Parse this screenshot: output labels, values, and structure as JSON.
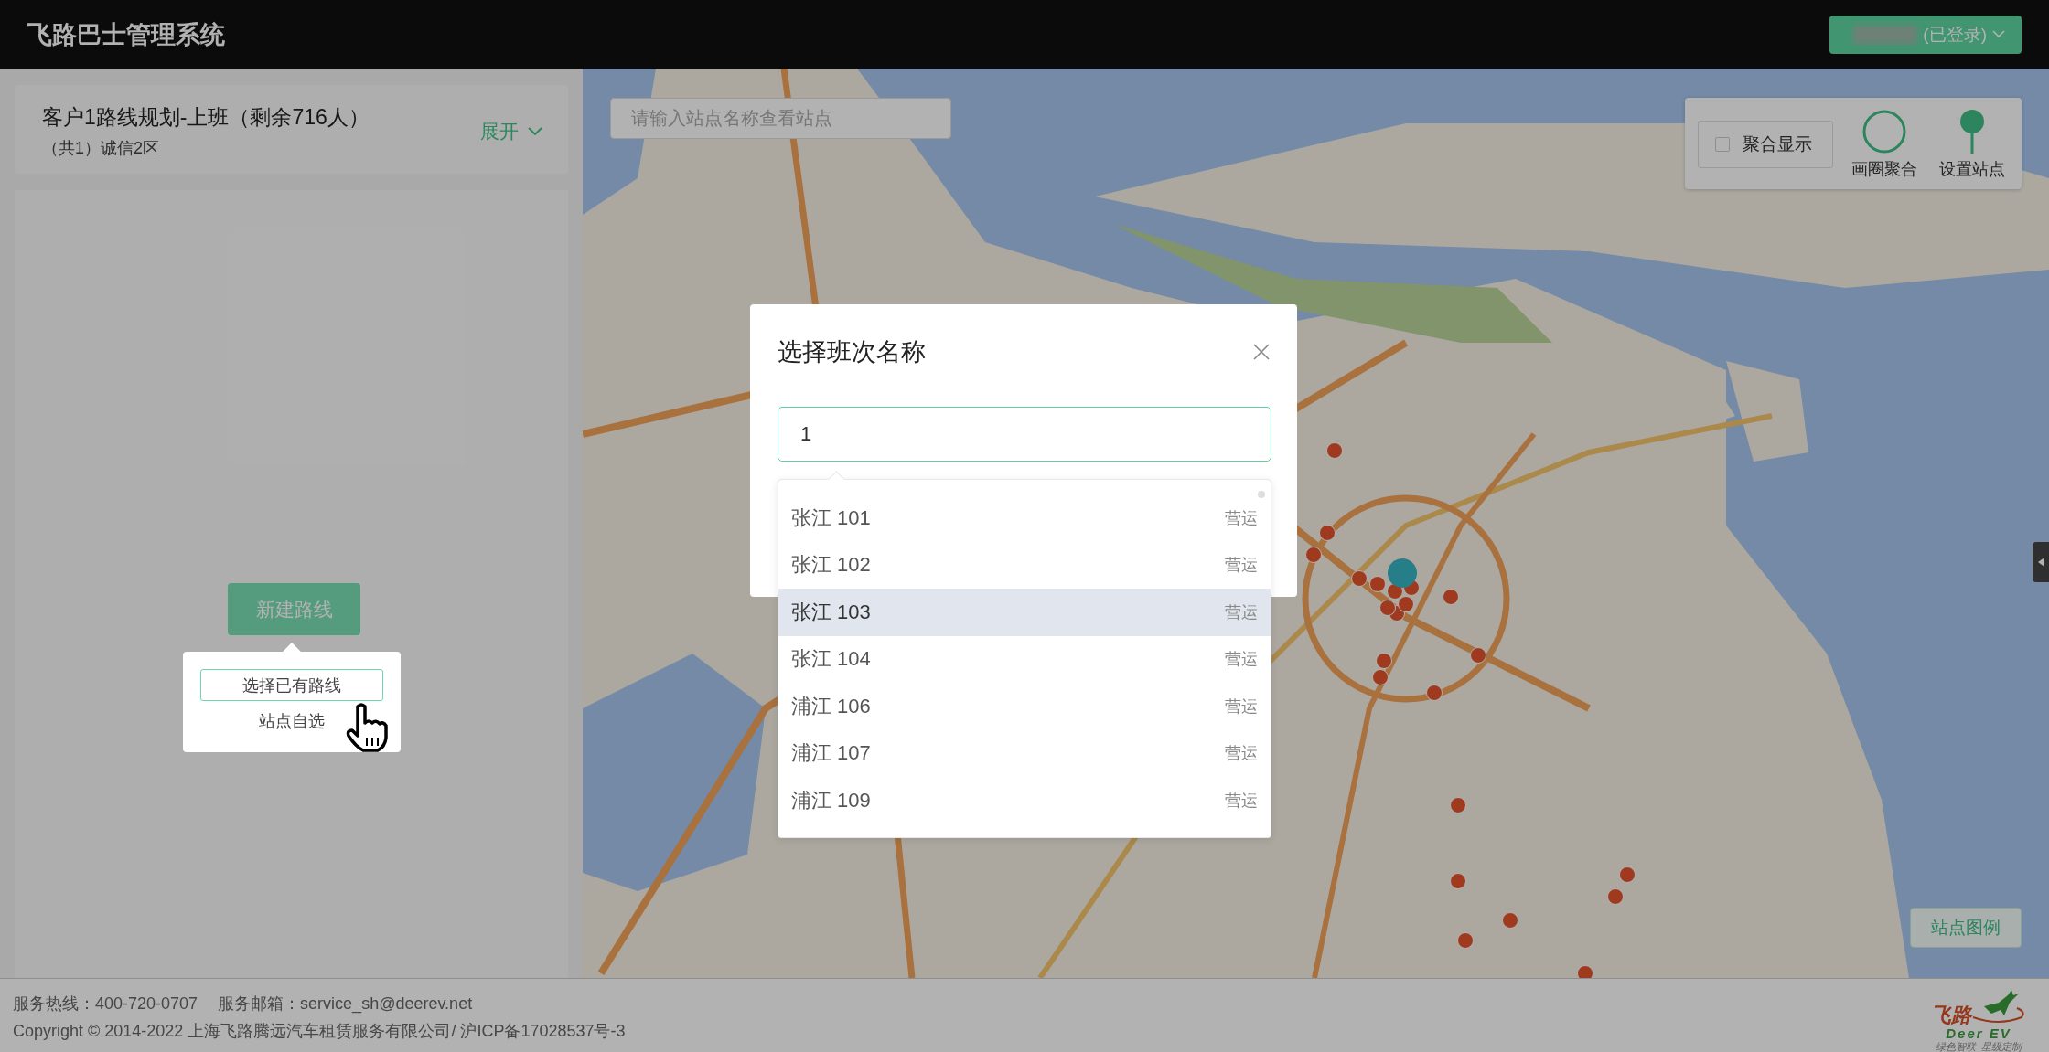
{
  "header": {
    "title": "飞路巴士管理系统",
    "user_button": {
      "label": "(已登录)"
    }
  },
  "route_card": {
    "title": "客户1路线规划-上班（剩余716人）",
    "subtitle": "（共1）诚信2区",
    "expand_label": "展开"
  },
  "new_route_button": {
    "label": "新建路线"
  },
  "new_route_menu": [
    {
      "label": "选择已有路线",
      "highlighted": true
    },
    {
      "label": "站点自选",
      "highlighted": false
    }
  ],
  "map": {
    "search": {
      "placeholder": "请输入站点名称查看站点"
    },
    "cluster_toggle": {
      "label": "聚合显示",
      "checked": false
    },
    "tools": [
      {
        "kind": "circle",
        "label": "画圈聚合"
      },
      {
        "kind": "pin",
        "label": "设置站点"
      }
    ],
    "legend_button": {
      "label": "站点图例"
    }
  },
  "dialog": {
    "title": "选择班次名称",
    "input": {
      "value": "1"
    },
    "options": [
      {
        "name": "张江 101",
        "status": "营运",
        "highlighted": false
      },
      {
        "name": "张江 102",
        "status": "营运",
        "highlighted": false
      },
      {
        "name": "张江 103",
        "status": "营运",
        "highlighted": true
      },
      {
        "name": "张江 104",
        "status": "营运",
        "highlighted": false
      },
      {
        "name": "浦江 106",
        "status": "营运",
        "highlighted": false
      },
      {
        "name": "浦江 107",
        "status": "营运",
        "highlighted": false
      },
      {
        "name": "浦江 109",
        "status": "营运",
        "highlighted": false
      }
    ]
  },
  "footer": {
    "contacts": [
      "服务热线：400-720-0707",
      "服务邮箱：service_sh@deerev.net"
    ],
    "copyright": "Copyright © 2014-2022 上海飞路腾远汽车租赁服务有限公司/ 沪ICP备17028537号-3"
  },
  "logo": {
    "brand": "飞路",
    "latin": "Deer EV",
    "slogan": "绿色智联  星级定制"
  }
}
